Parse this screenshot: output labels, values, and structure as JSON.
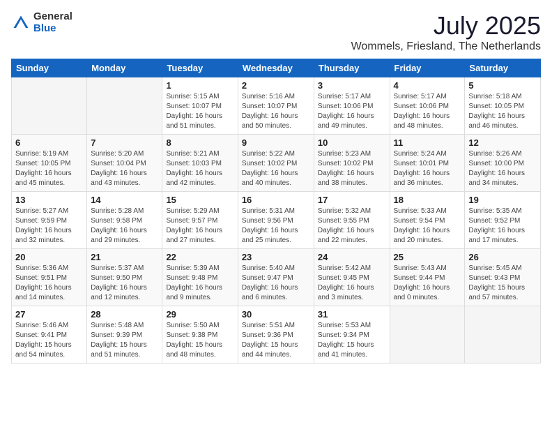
{
  "logo": {
    "general": "General",
    "blue": "Blue"
  },
  "header": {
    "title": "July 2025",
    "location": "Wommels, Friesland, The Netherlands"
  },
  "weekdays": [
    "Sunday",
    "Monday",
    "Tuesday",
    "Wednesday",
    "Thursday",
    "Friday",
    "Saturday"
  ],
  "weeks": [
    [
      {
        "day": "",
        "info": ""
      },
      {
        "day": "",
        "info": ""
      },
      {
        "day": "1",
        "info": "Sunrise: 5:15 AM\nSunset: 10:07 PM\nDaylight: 16 hours and 51 minutes."
      },
      {
        "day": "2",
        "info": "Sunrise: 5:16 AM\nSunset: 10:07 PM\nDaylight: 16 hours and 50 minutes."
      },
      {
        "day": "3",
        "info": "Sunrise: 5:17 AM\nSunset: 10:06 PM\nDaylight: 16 hours and 49 minutes."
      },
      {
        "day": "4",
        "info": "Sunrise: 5:17 AM\nSunset: 10:06 PM\nDaylight: 16 hours and 48 minutes."
      },
      {
        "day": "5",
        "info": "Sunrise: 5:18 AM\nSunset: 10:05 PM\nDaylight: 16 hours and 46 minutes."
      }
    ],
    [
      {
        "day": "6",
        "info": "Sunrise: 5:19 AM\nSunset: 10:05 PM\nDaylight: 16 hours and 45 minutes."
      },
      {
        "day": "7",
        "info": "Sunrise: 5:20 AM\nSunset: 10:04 PM\nDaylight: 16 hours and 43 minutes."
      },
      {
        "day": "8",
        "info": "Sunrise: 5:21 AM\nSunset: 10:03 PM\nDaylight: 16 hours and 42 minutes."
      },
      {
        "day": "9",
        "info": "Sunrise: 5:22 AM\nSunset: 10:02 PM\nDaylight: 16 hours and 40 minutes."
      },
      {
        "day": "10",
        "info": "Sunrise: 5:23 AM\nSunset: 10:02 PM\nDaylight: 16 hours and 38 minutes."
      },
      {
        "day": "11",
        "info": "Sunrise: 5:24 AM\nSunset: 10:01 PM\nDaylight: 16 hours and 36 minutes."
      },
      {
        "day": "12",
        "info": "Sunrise: 5:26 AM\nSunset: 10:00 PM\nDaylight: 16 hours and 34 minutes."
      }
    ],
    [
      {
        "day": "13",
        "info": "Sunrise: 5:27 AM\nSunset: 9:59 PM\nDaylight: 16 hours and 32 minutes."
      },
      {
        "day": "14",
        "info": "Sunrise: 5:28 AM\nSunset: 9:58 PM\nDaylight: 16 hours and 29 minutes."
      },
      {
        "day": "15",
        "info": "Sunrise: 5:29 AM\nSunset: 9:57 PM\nDaylight: 16 hours and 27 minutes."
      },
      {
        "day": "16",
        "info": "Sunrise: 5:31 AM\nSunset: 9:56 PM\nDaylight: 16 hours and 25 minutes."
      },
      {
        "day": "17",
        "info": "Sunrise: 5:32 AM\nSunset: 9:55 PM\nDaylight: 16 hours and 22 minutes."
      },
      {
        "day": "18",
        "info": "Sunrise: 5:33 AM\nSunset: 9:54 PM\nDaylight: 16 hours and 20 minutes."
      },
      {
        "day": "19",
        "info": "Sunrise: 5:35 AM\nSunset: 9:52 PM\nDaylight: 16 hours and 17 minutes."
      }
    ],
    [
      {
        "day": "20",
        "info": "Sunrise: 5:36 AM\nSunset: 9:51 PM\nDaylight: 16 hours and 14 minutes."
      },
      {
        "day": "21",
        "info": "Sunrise: 5:37 AM\nSunset: 9:50 PM\nDaylight: 16 hours and 12 minutes."
      },
      {
        "day": "22",
        "info": "Sunrise: 5:39 AM\nSunset: 9:48 PM\nDaylight: 16 hours and 9 minutes."
      },
      {
        "day": "23",
        "info": "Sunrise: 5:40 AM\nSunset: 9:47 PM\nDaylight: 16 hours and 6 minutes."
      },
      {
        "day": "24",
        "info": "Sunrise: 5:42 AM\nSunset: 9:45 PM\nDaylight: 16 hours and 3 minutes."
      },
      {
        "day": "25",
        "info": "Sunrise: 5:43 AM\nSunset: 9:44 PM\nDaylight: 16 hours and 0 minutes."
      },
      {
        "day": "26",
        "info": "Sunrise: 5:45 AM\nSunset: 9:43 PM\nDaylight: 15 hours and 57 minutes."
      }
    ],
    [
      {
        "day": "27",
        "info": "Sunrise: 5:46 AM\nSunset: 9:41 PM\nDaylight: 15 hours and 54 minutes."
      },
      {
        "day": "28",
        "info": "Sunrise: 5:48 AM\nSunset: 9:39 PM\nDaylight: 15 hours and 51 minutes."
      },
      {
        "day": "29",
        "info": "Sunrise: 5:50 AM\nSunset: 9:38 PM\nDaylight: 15 hours and 48 minutes."
      },
      {
        "day": "30",
        "info": "Sunrise: 5:51 AM\nSunset: 9:36 PM\nDaylight: 15 hours and 44 minutes."
      },
      {
        "day": "31",
        "info": "Sunrise: 5:53 AM\nSunset: 9:34 PM\nDaylight: 15 hours and 41 minutes."
      },
      {
        "day": "",
        "info": ""
      },
      {
        "day": "",
        "info": ""
      }
    ]
  ]
}
